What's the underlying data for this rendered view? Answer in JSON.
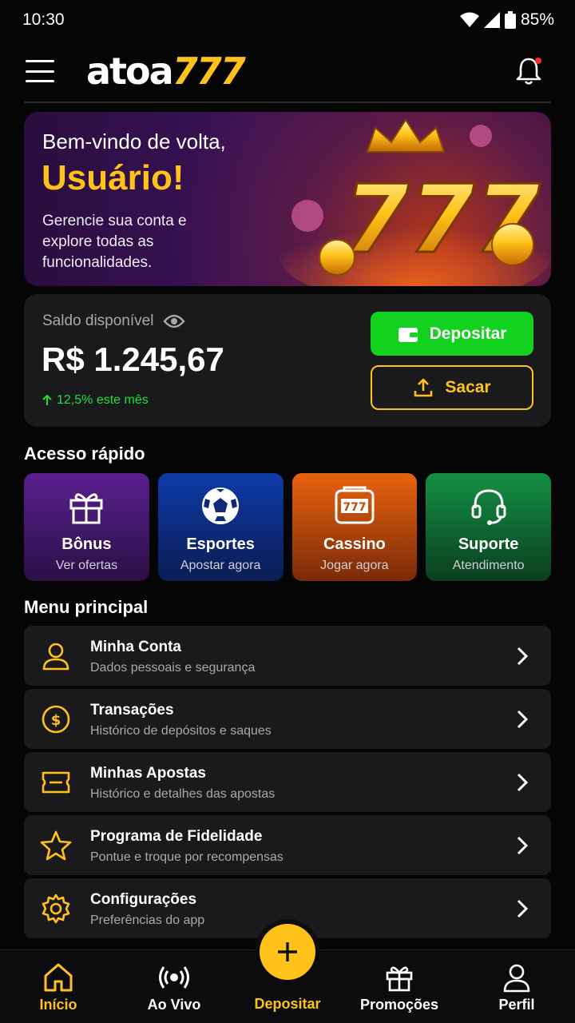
{
  "status": {
    "time": "10:30",
    "battery": "85%"
  },
  "header": {
    "logo_part1": "atoa",
    "logo_part2": "777"
  },
  "hero": {
    "greeting": "Bem-vindo de volta,",
    "name": "Usuário!",
    "description": "Gerencie sua conta e explore todas as funcionalidades."
  },
  "balance": {
    "label": "Saldo disponível",
    "value": "R$ 1.245,67",
    "change": "12,5% este mês",
    "deposit_label": "Depositar",
    "withdraw_label": "Sacar"
  },
  "quick_access": {
    "title": "Acesso rápido",
    "items": [
      {
        "title": "Bônus",
        "subtitle": "Ver ofertas",
        "icon": "gift-icon"
      },
      {
        "title": "Esportes",
        "subtitle": "Apostar agora",
        "icon": "soccer-ball-icon"
      },
      {
        "title": "Cassino",
        "subtitle": "Jogar agora",
        "icon": "slot-machine-icon"
      },
      {
        "title": "Suporte",
        "subtitle": "Atendimento",
        "icon": "headset-icon"
      }
    ]
  },
  "menu": {
    "title": "Menu principal",
    "items": [
      {
        "title": "Minha Conta",
        "subtitle": "Dados pessoais e segurança",
        "icon": "user-icon"
      },
      {
        "title": "Transações",
        "subtitle": "Histórico de depósitos e saques",
        "icon": "dollar-coin-icon"
      },
      {
        "title": "Minhas Apostas",
        "subtitle": "Histórico e detalhes das apostas",
        "icon": "ticket-icon"
      },
      {
        "title": "Programa de Fidelidade",
        "subtitle": "Pontue e troque por recompensas",
        "icon": "star-icon"
      },
      {
        "title": "Configurações",
        "subtitle": "Preferências do app",
        "icon": "gear-icon"
      }
    ]
  },
  "bottom_nav": {
    "items": [
      {
        "label": "Início",
        "icon": "home-icon",
        "active": true
      },
      {
        "label": "Ao Vivo",
        "icon": "live-broadcast-icon"
      },
      {
        "label": "Depositar",
        "icon": "plus-icon"
      },
      {
        "label": "Promoções",
        "icon": "gift-icon"
      },
      {
        "label": "Perfil",
        "icon": "profile-icon"
      }
    ]
  },
  "colors": {
    "accent": "#ffc21a",
    "deposit": "#12d11f",
    "card": "#1a1a1c",
    "background": "#050505"
  }
}
